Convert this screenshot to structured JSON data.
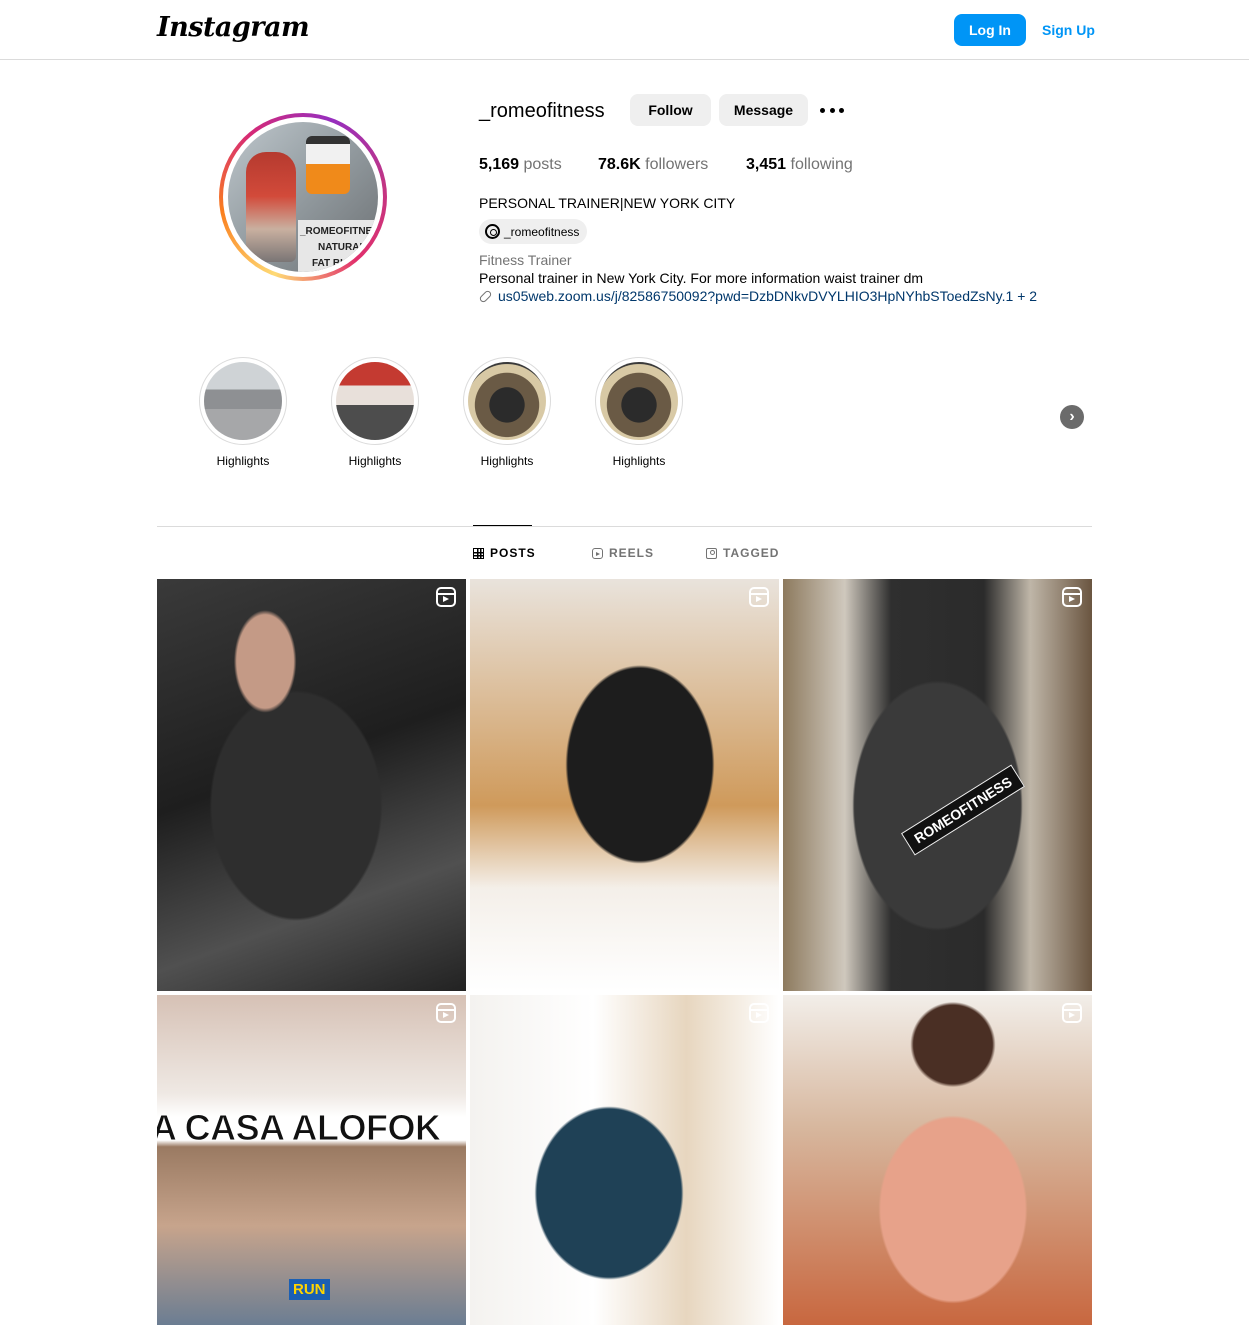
{
  "header": {
    "logo_text": "Instagram",
    "login_label": "Log In",
    "signup_label": "Sign Up",
    "accent_color": "#0095f6"
  },
  "profile": {
    "username": "_romeofitness",
    "follow_label": "Follow",
    "message_label": "Message",
    "more_icon": "more-horizontal-icon",
    "stats": {
      "posts_count": "5,169",
      "posts_label": "posts",
      "followers_count": "78.6K",
      "followers_label": "followers",
      "following_count": "3,451",
      "following_label": "following"
    },
    "full_name": "PERSONAL TRAINER|NEW YORK CITY",
    "threads_handle": "_romeofitness",
    "category": "Fitness Trainer",
    "bio": "Personal trainer in New York City. For more information waist trainer dm",
    "link_text": "us05web.zoom.us/j/82586750092?pwd=DzbDNkvDVYLHIO3HpNYhbSToedZsNy.1 + 2",
    "avatar_texts": [
      "_ROMEOFITNESS",
      "NATURAL",
      "FAT BURN"
    ]
  },
  "highlights": {
    "items": [
      {
        "label": "Highlights"
      },
      {
        "label": "Highlights"
      },
      {
        "label": "Highlights"
      },
      {
        "label": "Highlights"
      }
    ],
    "next_icon": "chevron-right-icon"
  },
  "tabs": [
    {
      "label": "POSTS",
      "icon": "grid-icon",
      "active": true
    },
    {
      "label": "REELS",
      "icon": "reels-icon",
      "active": false
    },
    {
      "label": "TAGGED",
      "icon": "tagged-icon",
      "active": false
    }
  ],
  "posts": {
    "overlay_texts": {
      "p3_tag": "ROMEOFITNESS",
      "p4_caption": "A CASA ALOFOK",
      "p4_mic": "RUN"
    },
    "type_icon": "reel-icon"
  }
}
